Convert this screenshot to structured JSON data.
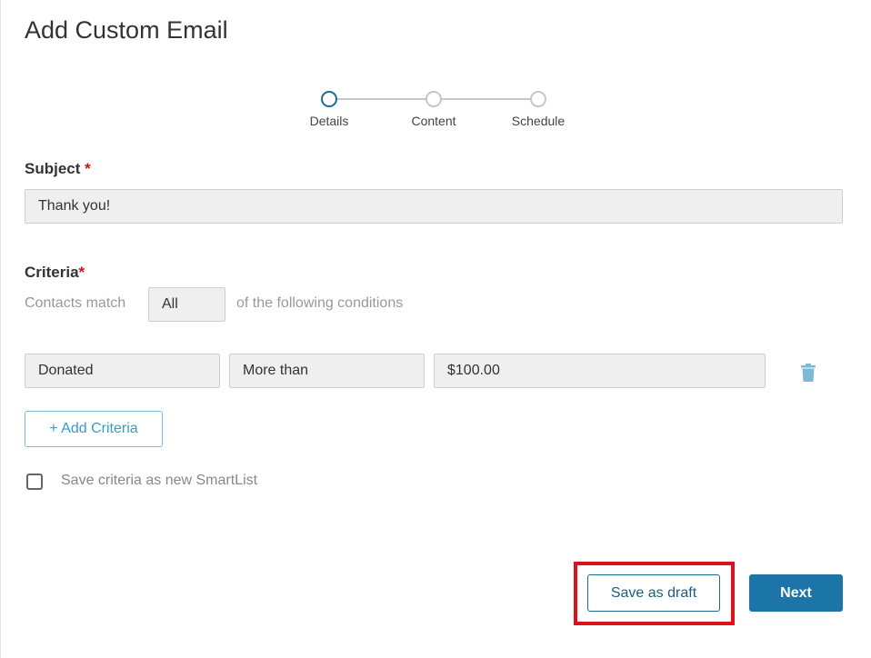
{
  "page": {
    "title": "Add Custom Email"
  },
  "stepper": {
    "steps": [
      {
        "label": "Details",
        "active": true
      },
      {
        "label": "Content",
        "active": false
      },
      {
        "label": "Schedule",
        "active": false
      }
    ]
  },
  "subject": {
    "label": "Subject",
    "required_mark": "*",
    "value": "Thank you!"
  },
  "criteria": {
    "label": "Criteria",
    "required_mark": "*",
    "match_prefix": "Contacts match",
    "match_value": "All",
    "match_suffix": "of the following conditions",
    "rows": [
      {
        "field": "Donated",
        "operator": "More than",
        "value": "$100.00"
      }
    ],
    "add_label": "+ Add Criteria",
    "save_smartlist_label": "Save criteria as new SmartList",
    "save_smartlist_checked": false
  },
  "actions": {
    "draft_label": "Save as draft",
    "next_label": "Next"
  },
  "colors": {
    "accent": "#1b75a6",
    "highlight": "#e0101a",
    "required": "#cc1111",
    "trash_icon": "#7db8d4"
  },
  "icons": {
    "delete": "trash-icon"
  }
}
